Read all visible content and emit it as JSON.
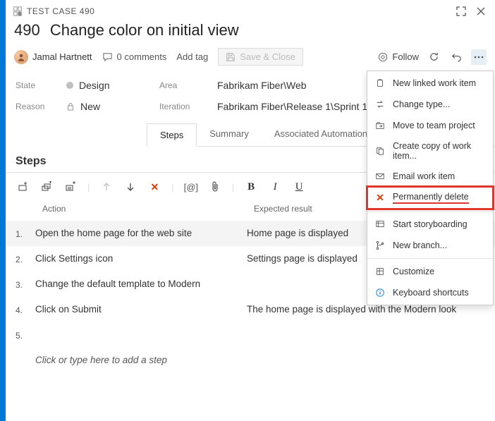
{
  "workItem": {
    "typeLabel": "TEST CASE 490",
    "id": "490",
    "title": "Change color on initial view",
    "assignee": "Jamal Hartnett",
    "commentsLabel": "0 comments",
    "addTagLabel": "Add tag",
    "saveLabel": "Save & Close",
    "followLabel": "Follow"
  },
  "fields": {
    "stateLabel": "State",
    "stateValue": "Design",
    "reasonLabel": "Reason",
    "reasonValue": "New",
    "areaLabel": "Area",
    "areaValue": "Fabrikam Fiber\\Web",
    "iterationLabel": "Iteration",
    "iterationValue": "Fabrikam Fiber\\Release 1\\Sprint 1"
  },
  "tabs": {
    "steps": "Steps",
    "summary": "Summary",
    "assoc": "Associated Automation"
  },
  "stepsSection": {
    "title": "Steps",
    "colAction": "Action",
    "colExpected": "Expected result",
    "rows": [
      {
        "n": "1.",
        "action": "Open the home page for the web site",
        "expected": "Home page is displayed"
      },
      {
        "n": "2.",
        "action": "Click Settings icon",
        "expected": "Settings page is displayed"
      },
      {
        "n": "3.",
        "action": "Change the default template to Modern",
        "expected": ""
      },
      {
        "n": "4.",
        "action": "Click on Submit",
        "expected": "The home page is displayed with the Modern look"
      },
      {
        "n": "5.",
        "action": "",
        "expected": ""
      }
    ],
    "placeholder": "Click or type here to add a step"
  },
  "menu": {
    "newLinked": "New linked work item",
    "changeType": "Change type...",
    "moveTeam": "Move to team project",
    "createCopy": "Create copy of work item...",
    "email": "Email work item",
    "permDelete": "Permanently delete",
    "storyboard": "Start storyboarding",
    "newBranch": "New branch...",
    "customize": "Customize",
    "shortcuts": "Keyboard shortcuts"
  }
}
